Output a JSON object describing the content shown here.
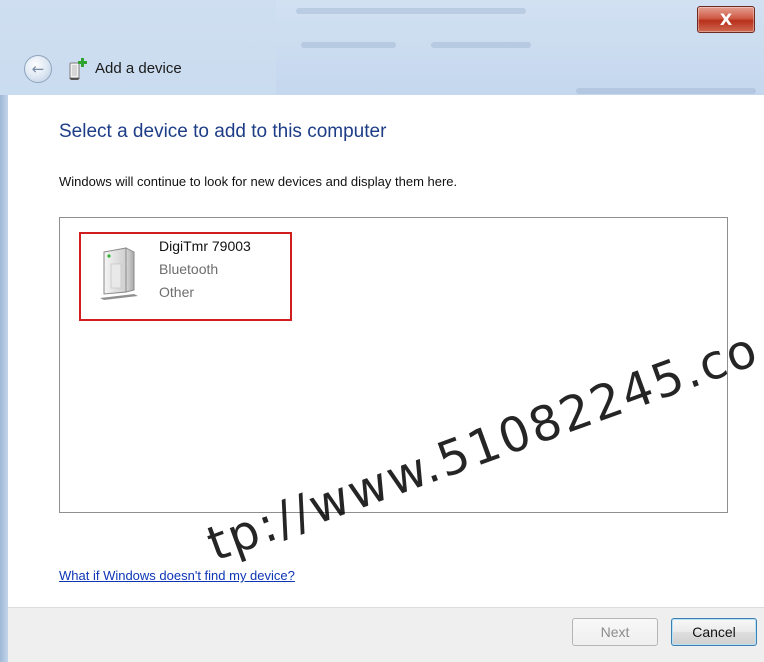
{
  "window": {
    "title": "Add a device",
    "close_label": "X"
  },
  "main": {
    "heading": "Select a device to add to this computer",
    "description": "Windows will continue to look for new devices and display them here.",
    "devices": [
      {
        "name": "DigiTmr 79003",
        "type": "Bluetooth",
        "category": "Other",
        "icon": "device-tower-icon"
      }
    ],
    "help_link": "What if Windows doesn't find my device?"
  },
  "footer": {
    "next_label": "Next",
    "cancel_label": "Cancel"
  },
  "watermark": "tp://www.51082245.co",
  "colors": {
    "heading": "#1e3d87",
    "link": "#0d36b5",
    "selection_border": "#d01e1e",
    "close_button": "#c7472f"
  }
}
